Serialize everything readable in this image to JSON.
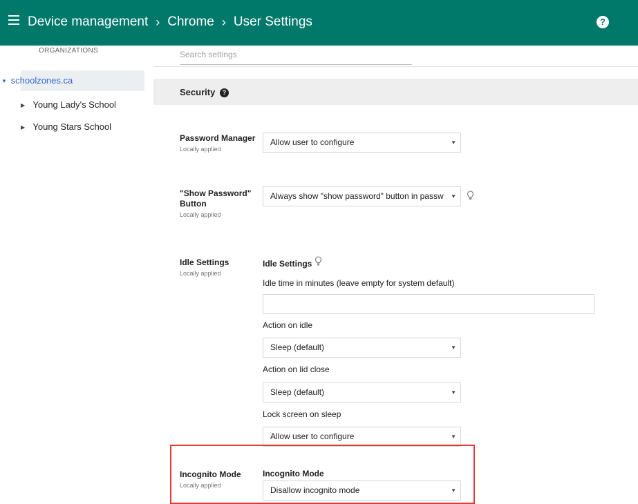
{
  "appbar": {
    "breadcrumbs": [
      "Device management",
      "Chrome",
      "User Settings"
    ],
    "separator": "›",
    "help_glyph": "?",
    "icons": {
      "menu": "menu-icon",
      "help": "help-circle-icon"
    },
    "color": "#00796b"
  },
  "sidebar": {
    "header": "ORGANIZATIONS",
    "root": {
      "label": "schoolzones.ca",
      "expanded": true
    },
    "children": [
      {
        "label": "Young Lady's School"
      },
      {
        "label": "Young Stars School"
      }
    ]
  },
  "search": {
    "placeholder": "Search settings",
    "value": ""
  },
  "section": {
    "title": "Security",
    "help_glyph": "?"
  },
  "settings": {
    "password_manager": {
      "label": "Password Manager",
      "status": "Locally applied",
      "value": "Allow user to configure"
    },
    "show_password": {
      "label_line1": "\"Show Password\"",
      "label_line2": "Button",
      "status": "Locally applied",
      "value": "Always show \"show password\" button in password fields"
    },
    "idle": {
      "label": "Idle Settings",
      "status": "Locally applied",
      "heading": "Idle Settings",
      "idle_time_label": "Idle time in minutes (leave empty for system default)",
      "idle_time_value": "",
      "action_on_idle_label": "Action on idle",
      "action_on_idle_value": "Sleep (default)",
      "lid_close_label": "Action on lid close",
      "lid_close_value": "Sleep (default)",
      "lock_screen_label": "Lock screen on sleep",
      "lock_screen_value": "Allow user to configure"
    },
    "incognito": {
      "label": "Incognito Mode",
      "status": "Locally applied",
      "heading": "Incognito Mode",
      "value": "Disallow incognito mode"
    }
  },
  "highlight_color": "#e53935"
}
